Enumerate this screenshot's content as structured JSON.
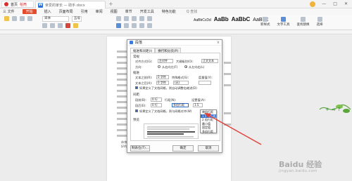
{
  "titlebar": {
    "home_tab": "首页",
    "home_tab_extra": "稻壳",
    "doc_tab": "亲爱的家长 — 助手.docx",
    "add_tab": "+"
  },
  "menubar": {
    "items": [
      "三 文件",
      "开始",
      "插入",
      "页面布局",
      "引用",
      "审阅",
      "视图",
      "章节",
      "开发工具",
      "特色功能",
      "Q 查找"
    ],
    "active_index": 1
  },
  "ribbon": {
    "font_name": "宋体",
    "font_size": "五号",
    "styles": [
      "AaBbCcDd",
      "AaBb",
      "AaBbC",
      "AaBbC"
    ],
    "right_tools": [
      "新样式",
      "文字工具",
      "查找替换",
      "选择"
    ]
  },
  "dialog": {
    "title": "段落",
    "close": "×",
    "tabs": [
      "缩进和间距(I)",
      "换行和分页(P)"
    ],
    "sections": {
      "general": "常规",
      "indent": "缩进",
      "spacing": "间距",
      "preview": "预览"
    },
    "labels": {
      "alignment": "对齐方式(G):",
      "alignment_value": "左对齐",
      "outline": "大纲级别(O):",
      "outline_value": "正文文本",
      "direction": "方向:",
      "rtl": "从右向左(F)",
      "ltr": "从左向右(L)",
      "before_text": "文本之前(R):",
      "before_value": "0 字符",
      "special": "特殊格式(S):",
      "measure": "度量值(Y):",
      "special_value": "(无)",
      "after_text": "文本之后(X):",
      "after_value": "0 字符",
      "auto_indent": "如果定义了文档网格，则自动调整右缩进(D)",
      "before_space": "段前(B):",
      "before_space_value": "0 行",
      "line_spacing": "行距(N):",
      "line_spacing_value": "多倍行距",
      "set_value": "设置值(A):",
      "set_value_value": "1.5",
      "after_space": "段后(E):",
      "after_space_value": "0 行",
      "grid_align": "如果定义了文档网格，则与网格对齐(W)"
    },
    "buttons": {
      "tabs": "制表位(T)...",
      "ok": "确定",
      "cancel": "取消"
    }
  },
  "dropdown": {
    "items": [
      "单倍行距",
      "1.5 倍行距",
      "2 倍行距",
      "最小值",
      "固定值",
      "多倍行距"
    ],
    "highlight_index": 1
  },
  "document": {
    "tail_text_1": "体育锻炼的积极性和自觉性，培养孩子终身体育锻炼的意识和习惯。",
    "tail_text_2": "好的方法，拿个一千成几个运动家写过的全部..."
  },
  "sidebar": {
    "icons": [
      "+",
      "<",
      "?"
    ]
  },
  "watermark": {
    "main": "Baidu 经验",
    "sub": "jingyan.baidu.com"
  },
  "colors": {
    "accent": "#e44b2d",
    "arrow": "#e0403a",
    "highlight": "#2f6fd0"
  }
}
